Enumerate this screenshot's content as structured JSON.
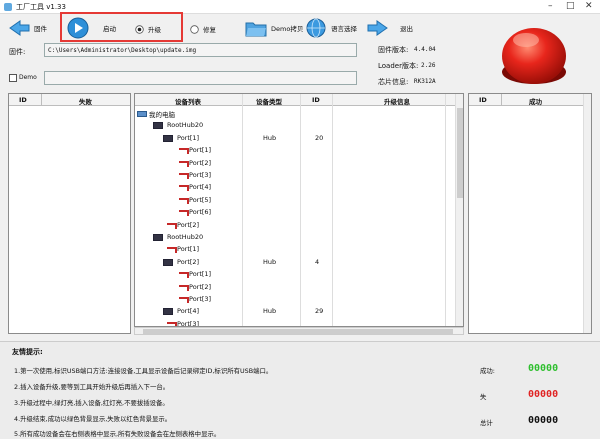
{
  "window": {
    "title": "工厂工具 v1.33"
  },
  "toolbar": {
    "firmware_label": "固件",
    "start_label": "启动",
    "upgrade_label": "升级",
    "repair_label": "修复",
    "demo_copy_label": "Demo拷贝",
    "language_label": "语言选择",
    "exit_label": "退出"
  },
  "firmware": {
    "label": "固件:",
    "path": "C:\\Users\\Administrator\\Desktop\\update.img",
    "version_label": "固件版本:",
    "version": "4.4.04",
    "loader_label": "Loader版本:",
    "loader_version": "2.26",
    "chip_label": "芯片信息:",
    "chip": "RK312A"
  },
  "demo": {
    "label": "Demo"
  },
  "fail_table": {
    "headers": [
      "ID",
      "失败"
    ]
  },
  "success_table": {
    "headers": [
      "ID",
      "成功"
    ]
  },
  "device_tree": {
    "headers": [
      "设备列表",
      "设备类型",
      "ID",
      "升级信息"
    ],
    "rows": [
      {
        "name": "我的电脑",
        "type": "",
        "id": ""
      },
      {
        "name": "RootHub20",
        "type": "",
        "id": ""
      },
      {
        "name": "Port[1]",
        "type": "Hub",
        "id": "20"
      },
      {
        "name": "Port[1]",
        "type": "",
        "id": ""
      },
      {
        "name": "Port[2]",
        "type": "",
        "id": ""
      },
      {
        "name": "Port[3]",
        "type": "",
        "id": ""
      },
      {
        "name": "Port[4]",
        "type": "",
        "id": ""
      },
      {
        "name": "Port[5]",
        "type": "",
        "id": ""
      },
      {
        "name": "Port[6]",
        "type": "",
        "id": ""
      },
      {
        "name": "Port[2]",
        "type": "",
        "id": ""
      },
      {
        "name": "RootHub20",
        "type": "",
        "id": ""
      },
      {
        "name": "Port[1]",
        "type": "",
        "id": ""
      },
      {
        "name": "Port[2]",
        "type": "Hub",
        "id": "4"
      },
      {
        "name": "Port[1]",
        "type": "",
        "id": ""
      },
      {
        "name": "Port[2]",
        "type": "",
        "id": ""
      },
      {
        "name": "Port[3]",
        "type": "",
        "id": ""
      },
      {
        "name": "Port[4]",
        "type": "Hub",
        "id": "29"
      },
      {
        "name": "Port[3]",
        "type": "",
        "id": ""
      }
    ]
  },
  "tips": {
    "title": "友情提示:",
    "items": [
      "1.第一次使用,标识USB端口方法:连接设备,工具显示设备后记录绑定ID,标识所有USB端口。",
      "2.插入设备升级,要等到工具开始升级后再插入下一台。",
      "3.升级过程中,绿灯亮,插入设备,红灯亮,不要拔插设备。",
      "4.升级结束,成功以绿色背景显示,失败以红色背景显示。",
      "5.所有成功设备会在右侧表格中显示,所有失败设备会在左侧表格中显示。"
    ]
  },
  "stats": {
    "success_label": "成功:",
    "success_count": "00000",
    "fail_label": "失",
    "fail_count": "00000",
    "total_label": "总计",
    "total_count": "00000"
  },
  "colors": {
    "success": "#2fbf2f",
    "fail": "#e02424",
    "highlight": "#e53935",
    "big_button": "#e8261c"
  }
}
